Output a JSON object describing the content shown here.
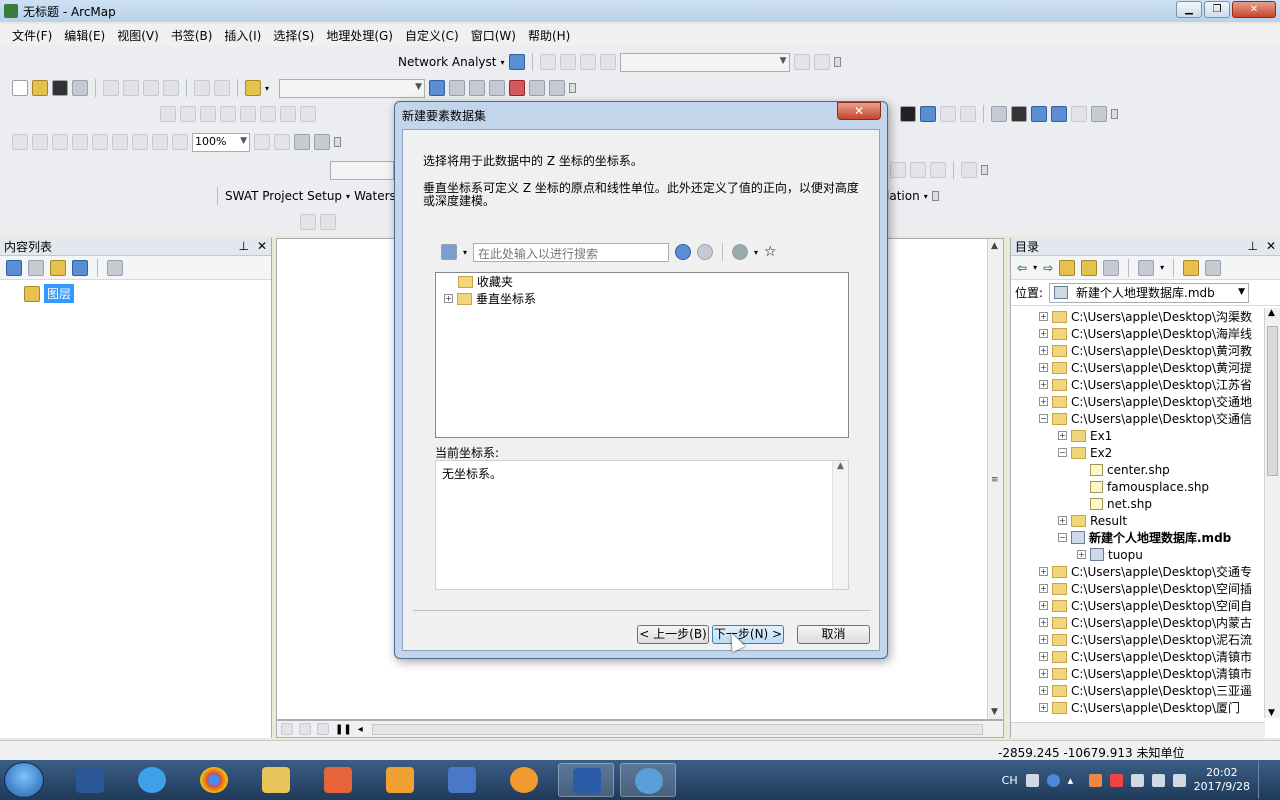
{
  "window": {
    "title": "无标题 - ArcMap"
  },
  "menu": [
    "文件(F)",
    "编辑(E)",
    "视图(V)",
    "书签(B)",
    "插入(I)",
    "选择(S)",
    "地理处理(G)",
    "自定义(C)",
    "窗口(W)",
    "帮助(H)"
  ],
  "toolbars": {
    "network_analyst": "Network Analyst",
    "zoom_value": "100%",
    "swat": "SWAT Project Setup",
    "waters": "Waters",
    "lation": "lation"
  },
  "toc": {
    "title": "内容列表",
    "layer_label": "图层"
  },
  "catalog": {
    "title": "目录",
    "location_label": "位置:",
    "location_value": "新建个人地理数据库.mdb",
    "items": [
      {
        "text": "C:\\Users\\apple\\Desktop\\沟渠数",
        "indent": 0,
        "expander": "+",
        "icon": "folder"
      },
      {
        "text": "C:\\Users\\apple\\Desktop\\海岸线",
        "indent": 0,
        "expander": "+",
        "icon": "folder"
      },
      {
        "text": "C:\\Users\\apple\\Desktop\\黄河教",
        "indent": 0,
        "expander": "+",
        "icon": "folder"
      },
      {
        "text": "C:\\Users\\apple\\Desktop\\黄河提",
        "indent": 0,
        "expander": "+",
        "icon": "folder"
      },
      {
        "text": "C:\\Users\\apple\\Desktop\\江苏省",
        "indent": 0,
        "expander": "+",
        "icon": "folder"
      },
      {
        "text": "C:\\Users\\apple\\Desktop\\交通地",
        "indent": 0,
        "expander": "+",
        "icon": "folder"
      },
      {
        "text": "C:\\Users\\apple\\Desktop\\交通信",
        "indent": 0,
        "expander": "−",
        "icon": "folder"
      },
      {
        "text": "Ex1",
        "indent": 1,
        "expander": "+",
        "icon": "folder"
      },
      {
        "text": "Ex2",
        "indent": 1,
        "expander": "−",
        "icon": "folder"
      },
      {
        "text": "center.shp",
        "indent": 2,
        "expander": "",
        "icon": "shp"
      },
      {
        "text": "famousplace.shp",
        "indent": 2,
        "expander": "",
        "icon": "shp"
      },
      {
        "text": "net.shp",
        "indent": 2,
        "expander": "",
        "icon": "shp"
      },
      {
        "text": "Result",
        "indent": 1,
        "expander": "+",
        "icon": "folder"
      },
      {
        "text": "新建个人地理数据库.mdb",
        "indent": 1,
        "expander": "−",
        "icon": "mdb",
        "bold": true
      },
      {
        "text": "tuopu",
        "indent": 2,
        "expander": "+",
        "icon": "mdb"
      },
      {
        "text": "C:\\Users\\apple\\Desktop\\交通专",
        "indent": 0,
        "expander": "+",
        "icon": "folder"
      },
      {
        "text": "C:\\Users\\apple\\Desktop\\空间插",
        "indent": 0,
        "expander": "+",
        "icon": "folder"
      },
      {
        "text": "C:\\Users\\apple\\Desktop\\空间自",
        "indent": 0,
        "expander": "+",
        "icon": "folder"
      },
      {
        "text": "C:\\Users\\apple\\Desktop\\内蒙古",
        "indent": 0,
        "expander": "+",
        "icon": "folder"
      },
      {
        "text": "C:\\Users\\apple\\Desktop\\泥石流",
        "indent": 0,
        "expander": "+",
        "icon": "folder"
      },
      {
        "text": "C:\\Users\\apple\\Desktop\\清镇市",
        "indent": 0,
        "expander": "+",
        "icon": "folder"
      },
      {
        "text": "C:\\Users\\apple\\Desktop\\清镇市",
        "indent": 0,
        "expander": "+",
        "icon": "folder"
      },
      {
        "text": "C:\\Users\\apple\\Desktop\\三亚遥",
        "indent": 0,
        "expander": "+",
        "icon": "folder"
      },
      {
        "text": "C:\\Users\\apple\\Desktop\\厦门",
        "indent": 0,
        "expander": "+",
        "icon": "folder"
      }
    ]
  },
  "status": {
    "coords": "-2859.245  -10679.913 未知单位"
  },
  "dialog": {
    "title": "新建要素数据集",
    "line1": "选择将用于此数据中的 Z 坐标的坐标系。",
    "line2": "垂直坐标系可定义 Z 坐标的原点和线性单位。此外还定义了值的正向，以便对高度或深度建模。",
    "search_placeholder": "在此处输入以进行搜索",
    "tree": [
      {
        "label": "收藏夹",
        "expander": ""
      },
      {
        "label": "垂直坐标系",
        "expander": "+"
      }
    ],
    "current_label": "当前坐标系:",
    "current_value": "无坐标系。",
    "btn_back": "< 上一步(B)",
    "btn_next": "下一步(N) >",
    "btn_cancel": "取消"
  },
  "taskbar": {
    "time": "20:02",
    "date": "2017/9/28",
    "ime": "CH"
  }
}
